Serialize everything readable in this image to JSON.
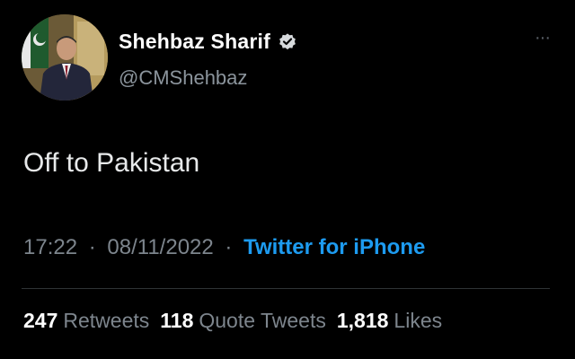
{
  "author": {
    "display_name": "Shehbaz Sharif",
    "handle": "@CMShehbaz"
  },
  "tweet": {
    "text": "Off to Pakistan",
    "time": "17:22",
    "date": "08/11/2022",
    "source": "Twitter for iPhone",
    "separator": "·"
  },
  "more_menu": {
    "label": "···"
  },
  "stats": {
    "retweets_count": "247",
    "retweets_label": "Retweets",
    "quotes_count": "118",
    "quotes_label": "Quote Tweets",
    "likes_count": "1,818",
    "likes_label": "Likes"
  },
  "colors": {
    "background": "#000000",
    "link": "#1d9bf0",
    "muted": "#7d858d",
    "text": "#e7e9ea"
  },
  "icons": {
    "verified": "verified-badge-icon",
    "more": "more-options-icon"
  }
}
